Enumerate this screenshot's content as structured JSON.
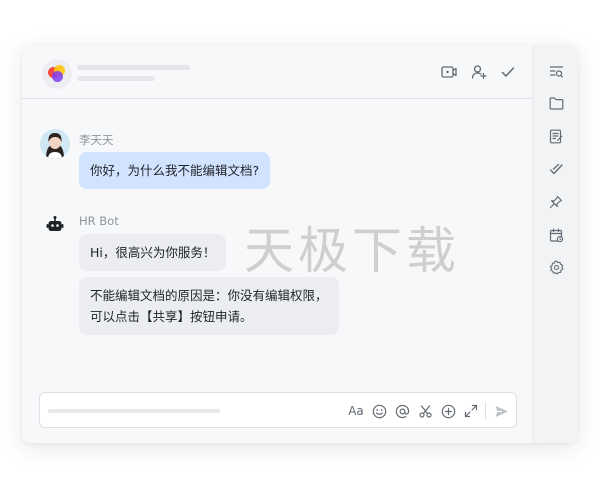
{
  "messages": [
    {
      "sender": "李天天",
      "bubbles": [
        "你好，为什么我不能编辑文档?"
      ]
    },
    {
      "sender": "HR Bot",
      "bubbles": [
        "Hi，很高兴为你服务！",
        "不能编辑文档的原因是：你没有编辑权限，",
        "可以点击【共享】按钮申请。"
      ]
    }
  ],
  "toolbar": {
    "font_label": "Aa"
  },
  "watermark": "天极下载",
  "header_icons": [
    "video-icon",
    "add-member-icon",
    "check-icon"
  ],
  "sidebar_icons": [
    "search-history-icon",
    "folder-icon",
    "document-icon",
    "task-check-icon",
    "pin-icon",
    "calendar-icon",
    "settings-icon"
  ],
  "colors": {
    "user_bubble": "#d1e3ff",
    "bot_bubble": "#ebedf0",
    "chat_bg": "#f7f8fa"
  }
}
